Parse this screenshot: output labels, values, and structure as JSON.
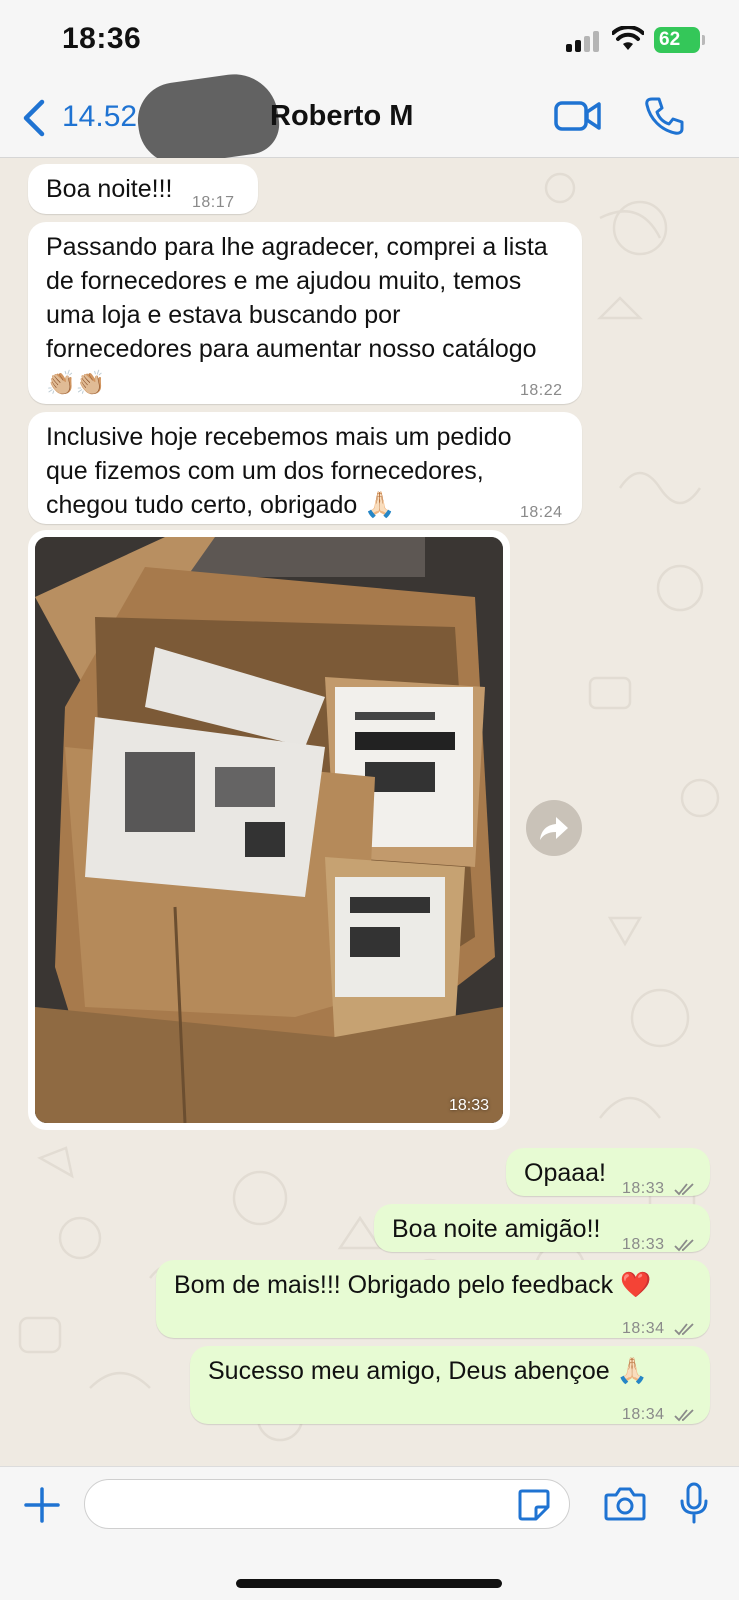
{
  "status_bar": {
    "time": "18:36",
    "battery": "62"
  },
  "header": {
    "back_label": "14.52",
    "contact_name": "Roberto M"
  },
  "messages": [
    {
      "direction": "in",
      "text": "Boa noite!!!",
      "time": "18:17"
    },
    {
      "direction": "in",
      "text": "Passando para lhe agradecer, comprei a lista\nde fornecedores e me ajudou muito, temos\numa loja e estava buscando por\nfornecedores para aumentar nosso catálogo",
      "emoji": "👏🏼👏🏼",
      "time": "18:22"
    },
    {
      "direction": "in",
      "text": "Inclusive hoje recebemos mais um pedido\nque fizemos com um dos fornecedores,\nchegou tudo certo, obrigado 🙏🏻",
      "time": "18:24"
    },
    {
      "direction": "in",
      "type": "photo",
      "time": "18:33"
    },
    {
      "direction": "out",
      "text": "Opaaa!",
      "time": "18:33"
    },
    {
      "direction": "out",
      "text": "Boa noite amigão!!",
      "time": "18:33"
    },
    {
      "direction": "out",
      "text": "Bom de mais!!! Obrigado pelo feedback ❤️",
      "time": "18:34"
    },
    {
      "direction": "out",
      "text": "Sucesso meu amigo, Deus abençoe 🙏🏻",
      "time": "18:34"
    }
  ],
  "colors": {
    "accent": "#1f73d2",
    "outgoing_bubble": "#e7fbd3",
    "incoming_bubble": "#ffffff",
    "read_ticks": "#8a8a8a",
    "battery": "#34c759"
  },
  "icons": [
    "back-chevron-icon",
    "video-call-icon",
    "phone-icon",
    "forward-icon",
    "plus-icon",
    "sticker-icon",
    "camera-icon",
    "microphone-icon"
  ]
}
